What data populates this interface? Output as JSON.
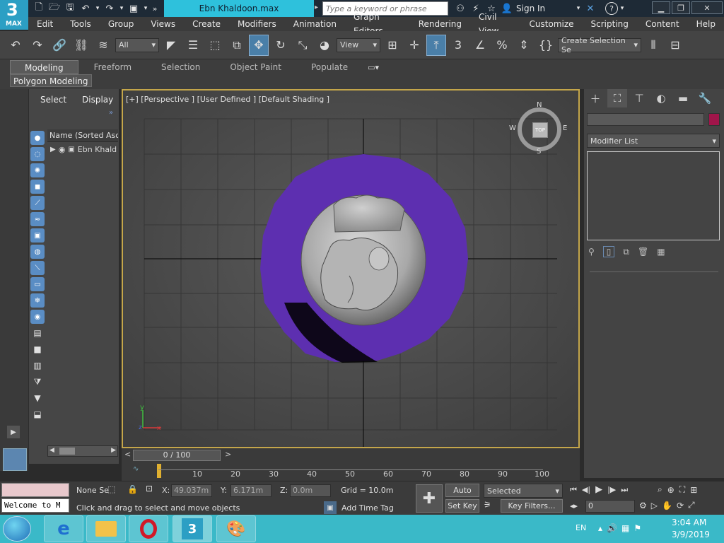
{
  "window": {
    "title": "Ebn Khaldoon.max",
    "logo_number": "3",
    "logo_text": "MAX",
    "search_placeholder": "Type a keyword or phrase",
    "sign_in": "Sign In"
  },
  "menu": [
    "Edit",
    "Tools",
    "Group",
    "Views",
    "Create",
    "Modifiers",
    "Animation",
    "Graph Editors",
    "Rendering",
    "Civil View",
    "Customize",
    "Scripting",
    "Content",
    "Help"
  ],
  "toolbar": {
    "filter_value": "All",
    "ref_coord_value": "View",
    "selection_set_value": "Create Selection Se"
  },
  "ribbon": {
    "tabs": [
      "Modeling",
      "Freeform",
      "Selection",
      "Object Paint",
      "Populate"
    ],
    "active_tab": "Modeling",
    "panel_label": "Polygon Modeling"
  },
  "scene_explorer": {
    "tabs": [
      "Select",
      "Display"
    ],
    "column_header": "Name (Sorted Ascen",
    "item": "Ebn Khald"
  },
  "viewport": {
    "label": "[+] [Perspective ] [User Defined ] [Default Shading ]",
    "viewcube": {
      "n": "N",
      "s": "S",
      "e": "E",
      "w": "W",
      "face": "TOP"
    }
  },
  "command_panel": {
    "modifier_list": "Modifier List",
    "accent_color": "#a0154a"
  },
  "time": {
    "frame_display": "0 / 100",
    "ticks": [
      "0",
      "10",
      "20",
      "30",
      "40",
      "50",
      "60",
      "70",
      "80",
      "90",
      "100"
    ]
  },
  "status": {
    "maxscript": "Welcome to M",
    "selection": "None Se",
    "x_label": "X:",
    "x_value": "49.037m",
    "y_label": "Y:",
    "y_value": "6.171m",
    "z_label": "Z:",
    "z_value": "0.0m",
    "grid": "Grid = 10.0m",
    "prompt": "Click and drag to select and move objects",
    "add_time_tag": "Add Time Tag",
    "auto_key": "Auto Key",
    "set_key": "Set Key",
    "selected_dd": "Selected",
    "key_filters": "Key Filters...",
    "frame_field": "0"
  },
  "taskbar": {
    "lang": "EN",
    "time": "3:04 AM",
    "date": "3/9/2019"
  }
}
